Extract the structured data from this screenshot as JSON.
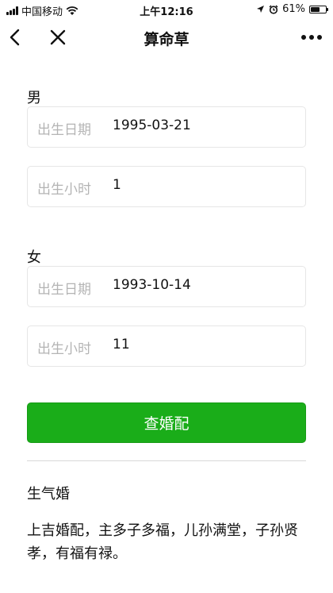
{
  "status_bar": {
    "carrier": "中国移动",
    "time": "上午12:16",
    "battery_percent": "61%",
    "battery_level": 0.61
  },
  "nav": {
    "title": "算命草",
    "back_icon": "chevron-left-icon",
    "close_icon": "close-icon",
    "more_icon": "more-dots-icon"
  },
  "male": {
    "section_label": "男",
    "birth_date_label": "出生日期",
    "birth_date_value": "1995-03-21",
    "birth_hour_label": "出生小时",
    "birth_hour_value": "1"
  },
  "female": {
    "section_label": "女",
    "birth_date_label": "出生日期",
    "birth_date_value": "1993-10-14",
    "birth_hour_label": "出生小时",
    "birth_hour_value": "11"
  },
  "match_button": {
    "label": "查婚配",
    "color": "#1aad19"
  },
  "result": {
    "title": "生气婚",
    "description": "上吉婚配，主多子多福，儿孙满堂，子孙贤孝，有福有禄。"
  }
}
